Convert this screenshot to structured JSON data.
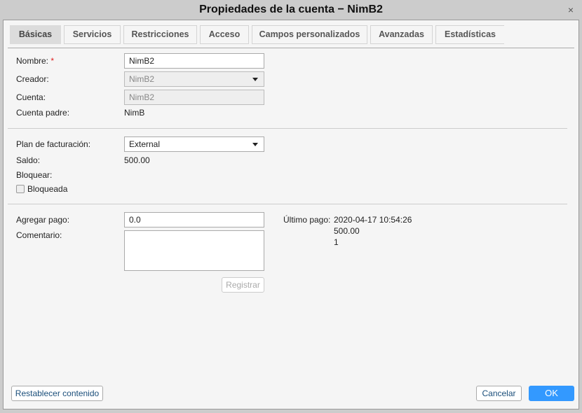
{
  "window": {
    "title": "Propiedades de la cuenta − NimB2",
    "close_icon": "×"
  },
  "tabs": [
    {
      "label": "Básicas"
    },
    {
      "label": "Servicios"
    },
    {
      "label": "Restricciones"
    },
    {
      "label": "Acceso"
    },
    {
      "label": "Campos personalizados"
    },
    {
      "label": "Avanzadas"
    },
    {
      "label": "Estadísticas"
    }
  ],
  "form": {
    "nombre_label": "Nombre:",
    "required_mark": "*",
    "nombre_value": "NimB2",
    "creador_label": "Creador:",
    "creador_value": "NimB2",
    "cuenta_label": "Cuenta:",
    "cuenta_value": "NimB2",
    "cuenta_padre_label": "Cuenta padre:",
    "cuenta_padre_value": "NimB",
    "plan_label": "Plan de facturación:",
    "plan_value": "External",
    "saldo_label": "Saldo:",
    "saldo_value": "500.00",
    "bloquear_label": "Bloquear:",
    "bloqueada_label": "Bloqueada",
    "bloqueada_checked": false,
    "agregar_label": "Agregar pago:",
    "agregar_value": "0.0",
    "comentario_label": "Comentario:",
    "comentario_value": "",
    "registrar_label": "Registrar",
    "ultimo_label": "Último pago:",
    "ultimo_fecha": "2020-04-17 10:54:26",
    "ultimo_monto": "500.00",
    "ultimo_id": "1"
  },
  "footer": {
    "reset_label": "Restablecer contenido",
    "cancel_label": "Cancelar",
    "ok_label": "OK"
  },
  "colors": {
    "accent": "#3399ff",
    "required": "#e02020"
  }
}
